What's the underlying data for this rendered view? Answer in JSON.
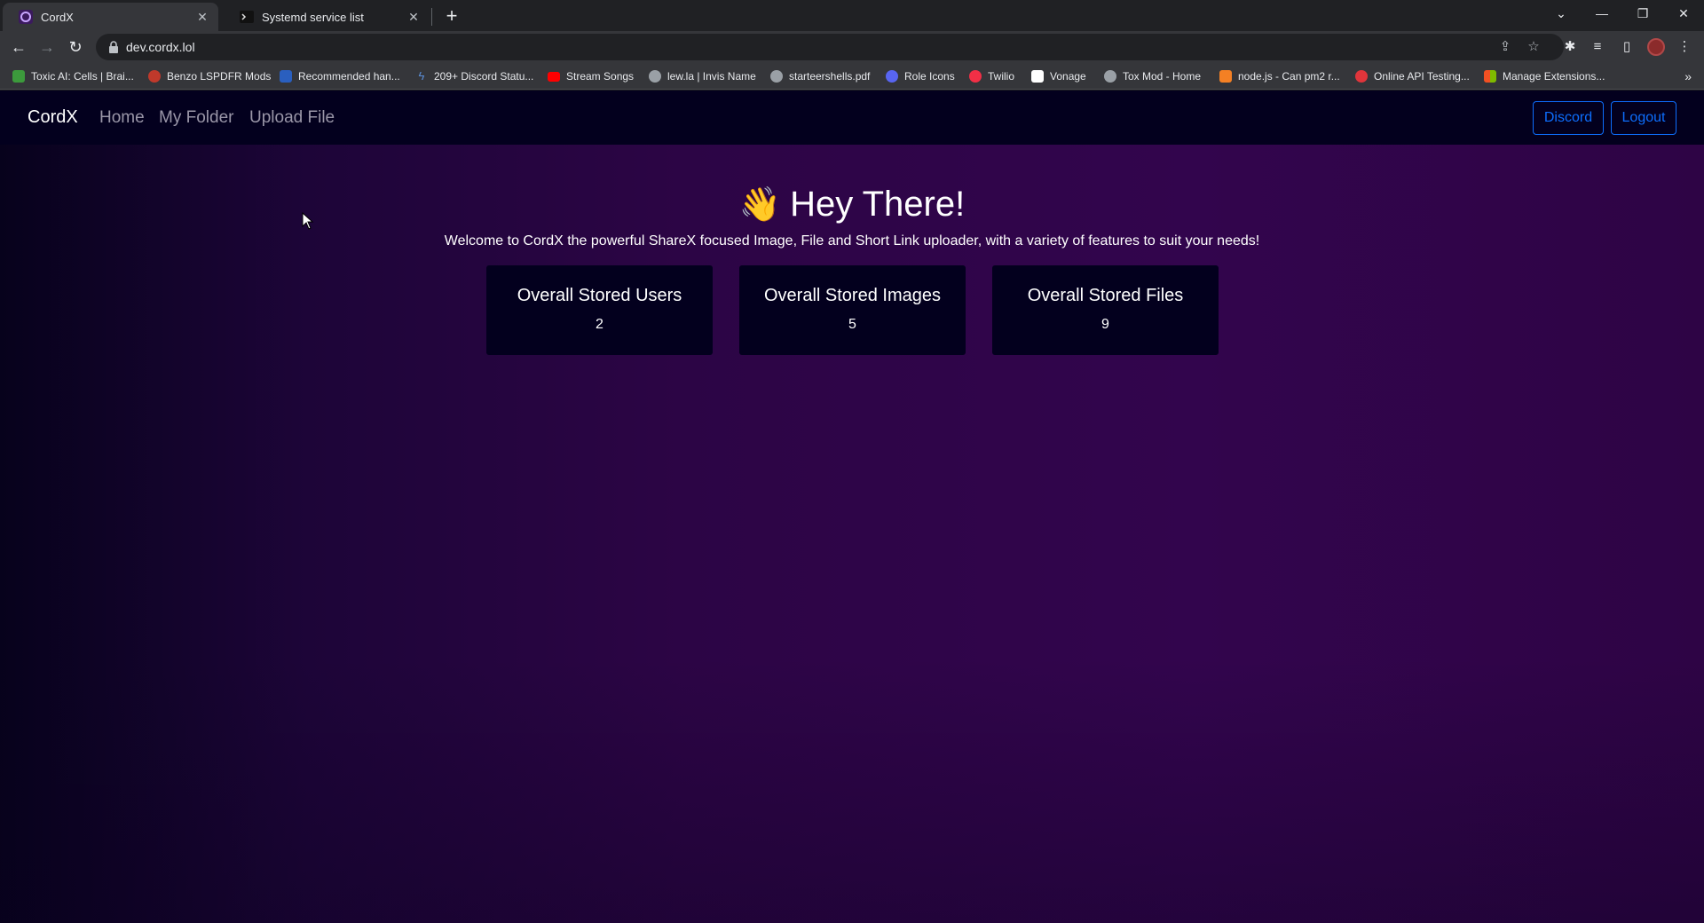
{
  "browser": {
    "tabs": [
      {
        "title": "CordX",
        "active": true,
        "icon": "cordx-favicon"
      },
      {
        "title": "Systemd service list",
        "active": false,
        "icon": "terminal-favicon"
      }
    ],
    "url": "dev.cordx.lol",
    "bookmarks": [
      {
        "label": "Toxic AI: Cells | Brai...",
        "icon": "green-icon",
        "color": "#3c9a3c"
      },
      {
        "label": "Benzo LSPDFR Mods",
        "icon": "heart-icon",
        "color": "#c0392b"
      },
      {
        "label": "Recommended han...",
        "icon": "blue-icon",
        "color": "#2a5fbf"
      },
      {
        "label": "209+ Discord Statu...",
        "icon": "lightning-icon",
        "color": "#5b8dd6"
      },
      {
        "label": "Stream Songs",
        "icon": "youtube-icon",
        "color": "#ff0000"
      },
      {
        "label": "lew.la | Invis Name",
        "icon": "globe-icon",
        "color": "#9aa0a6"
      },
      {
        "label": "starteershells.pdf",
        "icon": "globe-icon",
        "color": "#9aa0a6"
      },
      {
        "label": "Role Icons",
        "icon": "gear-icon",
        "color": "#5865f2"
      },
      {
        "label": "Twilio",
        "icon": "twilio-icon",
        "color": "#f22f46"
      },
      {
        "label": "Vonage",
        "icon": "vonage-icon",
        "color": "#ffffff"
      },
      {
        "label": "Tox Mod - Home",
        "icon": "globe-icon",
        "color": "#9aa0a6"
      },
      {
        "label": "node.js - Can pm2 r...",
        "icon": "stackoverflow-icon",
        "color": "#f48024"
      },
      {
        "label": "Online API Testing...",
        "icon": "api-icon",
        "color": "#e0353b"
      },
      {
        "label": "Manage Extensions...",
        "icon": "microsoft-icon",
        "color": "#f25022"
      }
    ]
  },
  "site": {
    "brand": "CordX",
    "nav": [
      "Home",
      "My Folder",
      "Upload File"
    ],
    "buttons": {
      "discord": "Discord",
      "logout": "Logout"
    },
    "hero": {
      "emoji": "👋",
      "title": "Hey There!",
      "subtitle": "Welcome to CordX the powerful ShareX focused Image, File and Short Link uploader, with a variety of features to suit your needs!"
    },
    "stats": [
      {
        "label": "Overall Stored Users",
        "value": "2"
      },
      {
        "label": "Overall Stored Images",
        "value": "5"
      },
      {
        "label": "Overall Stored Files",
        "value": "9"
      }
    ]
  },
  "colors": {
    "nav_bg": "#03001e",
    "accent": "#0d6efd",
    "page_gradient_start": "#07021c",
    "page_gradient_end": "#32054d"
  }
}
